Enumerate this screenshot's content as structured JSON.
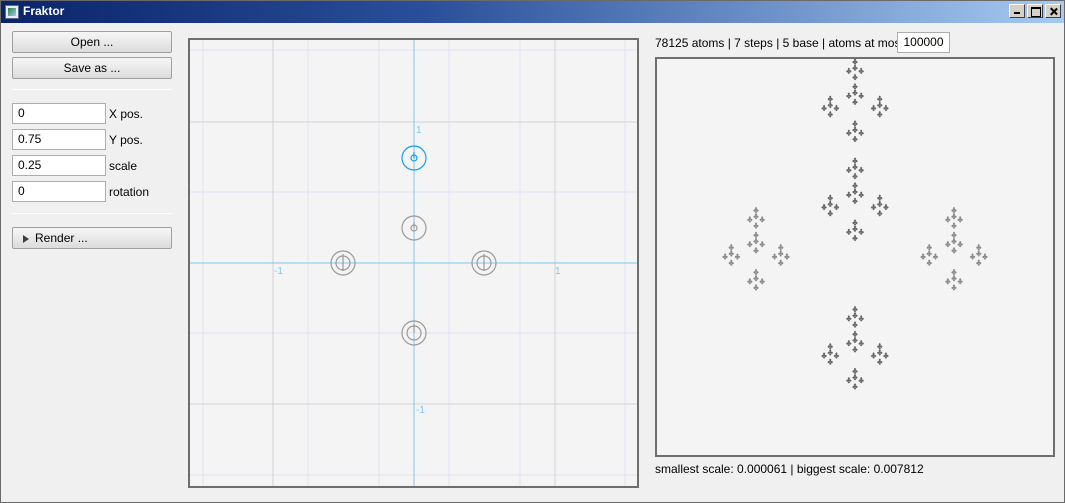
{
  "window": {
    "title": "Fraktor"
  },
  "toolbar": {
    "open_label": "Open ...",
    "save_label": "Save as ..."
  },
  "transform": {
    "x_value": "0",
    "x_label": "X pos.",
    "y_value": "0.75",
    "y_label": "Y pos.",
    "scale_value": "0.25",
    "scale_label": "scale",
    "rotation_value": "0",
    "rotation_label": "rotation"
  },
  "render": {
    "label": "Render ..."
  },
  "editor": {
    "axis_labels": {
      "top": "1",
      "bottom": "-1",
      "left": "-1",
      "right": "1"
    },
    "colors": {
      "axis": "#7ec8f0",
      "grid": "#d0d0d0",
      "subgrid": "#e2e2f4",
      "selected": "#10a0e8",
      "handle": "#9a9a9a"
    }
  },
  "status": {
    "info_text": "78125 atoms | 7 steps | 5 base | atoms at most:",
    "atoms_at_most": "100000",
    "scale_info": "smallest scale: 0.000061 | biggest scale: 0.007812"
  },
  "preview": {
    "fill_color": "#666666",
    "light_color": "#8a8a8a"
  }
}
